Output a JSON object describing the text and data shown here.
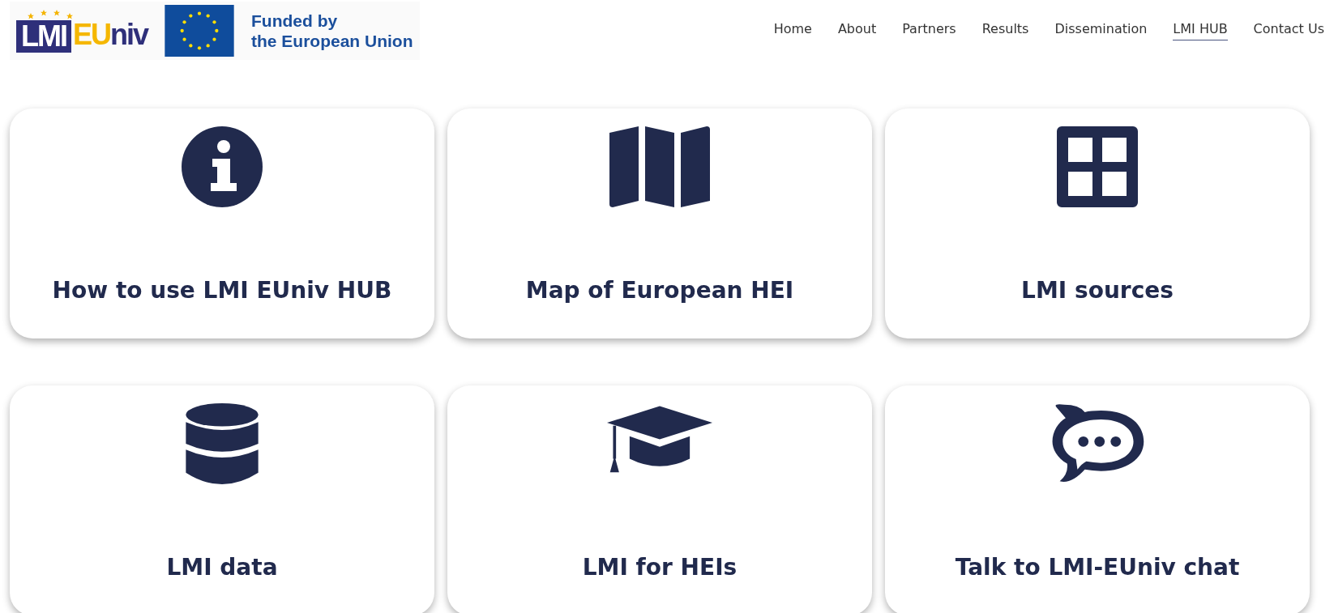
{
  "logo": {
    "part_1": "LMI",
    "part_2": "EU",
    "part_3": "niv"
  },
  "eu_badge": {
    "line_1": "Funded by",
    "line_2": "the European Union"
  },
  "nav": [
    {
      "label": "Home",
      "selected": false
    },
    {
      "label": "About",
      "selected": false
    },
    {
      "label": "Partners",
      "selected": false
    },
    {
      "label": "Results",
      "selected": false
    },
    {
      "label": "Dissemination",
      "selected": false
    },
    {
      "label": "LMI HUB",
      "selected": true
    },
    {
      "label": "Contact Us",
      "selected": false
    }
  ],
  "cards": [
    {
      "kind": "info",
      "title": "How to use LMI EUniv HUB"
    },
    {
      "kind": "map",
      "title": "Map of European HEI"
    },
    {
      "kind": "grid",
      "title": "LMI sources"
    },
    {
      "kind": "database",
      "title": "LMI data"
    },
    {
      "kind": "cap",
      "title": "LMI for HEIs"
    },
    {
      "kind": "chat",
      "title": "Talk to LMI-EUniv chat"
    }
  ]
}
